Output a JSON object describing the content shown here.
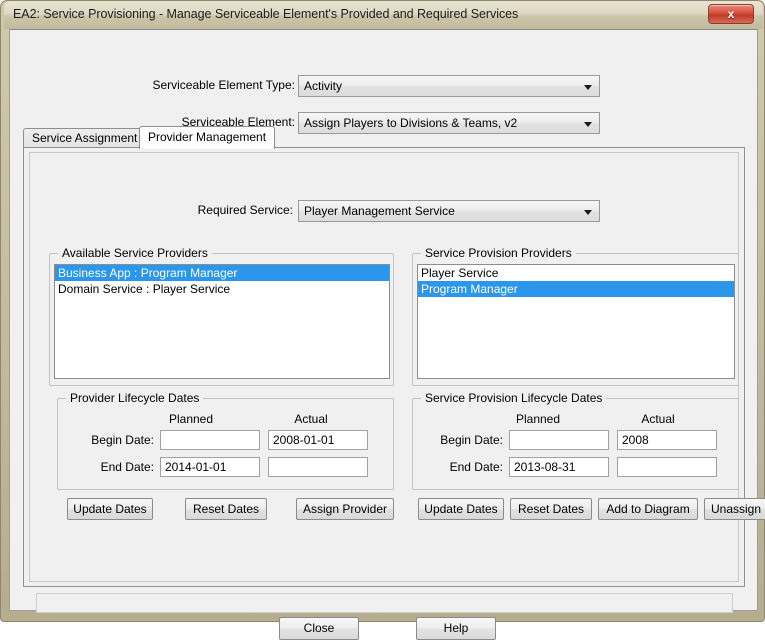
{
  "window": {
    "title": "EA2: Service Provisioning - Manage Serviceable Element's Provided and Required Services",
    "close_label": "x",
    "accent_selection_color": "#2a96ec",
    "frame_color": "#c6bfa3"
  },
  "top_form": {
    "element_type": {
      "label": "Serviceable Element Type:",
      "value": "Activity"
    },
    "element": {
      "label": "Serviceable Element:",
      "value": "Assign Players to Divisions & Teams, v2"
    }
  },
  "tabs": [
    {
      "label": "Service Assignment",
      "active": false
    },
    {
      "label": "Provider Management",
      "active": true
    }
  ],
  "required_service": {
    "label": "Required Service:",
    "value": "Player Management Service"
  },
  "available_providers": {
    "title": "Available Service Providers",
    "items": [
      {
        "text": "Business App : Program Manager",
        "selected": true
      },
      {
        "text": "Domain Service : Player Service",
        "selected": false
      }
    ]
  },
  "provision_providers": {
    "title": "Service Provision Providers",
    "items": [
      {
        "text": "Player Service",
        "selected": false
      },
      {
        "text": "Program Manager",
        "selected": true
      }
    ]
  },
  "provider_dates": {
    "title": "Provider Lifecycle Dates",
    "col_planned": "Planned",
    "col_actual": "Actual",
    "begin_label": "Begin Date:",
    "end_label": "End Date:",
    "begin_planned": "",
    "begin_actual": "2008-01-01",
    "end_planned": "2014-01-01",
    "end_actual": ""
  },
  "provision_dates": {
    "title": "Service Provision Lifecycle Dates",
    "col_planned": "Planned",
    "col_actual": "Actual",
    "begin_label": "Begin Date:",
    "end_label": "End Date:",
    "begin_planned": "",
    "begin_actual": "2008",
    "end_planned": "2013-08-31",
    "end_actual": ""
  },
  "left_buttons": {
    "update_dates": "Update Dates",
    "reset_dates": "Reset Dates",
    "assign_provider": "Assign Provider"
  },
  "right_buttons": {
    "update_dates": "Update Dates",
    "reset_dates": "Reset Dates",
    "add_to_diagram": "Add to Diagram",
    "unassign": "Unassign"
  },
  "status_bar": {
    "text": ""
  },
  "bottom_buttons": {
    "close": "Close",
    "help": "Help"
  }
}
